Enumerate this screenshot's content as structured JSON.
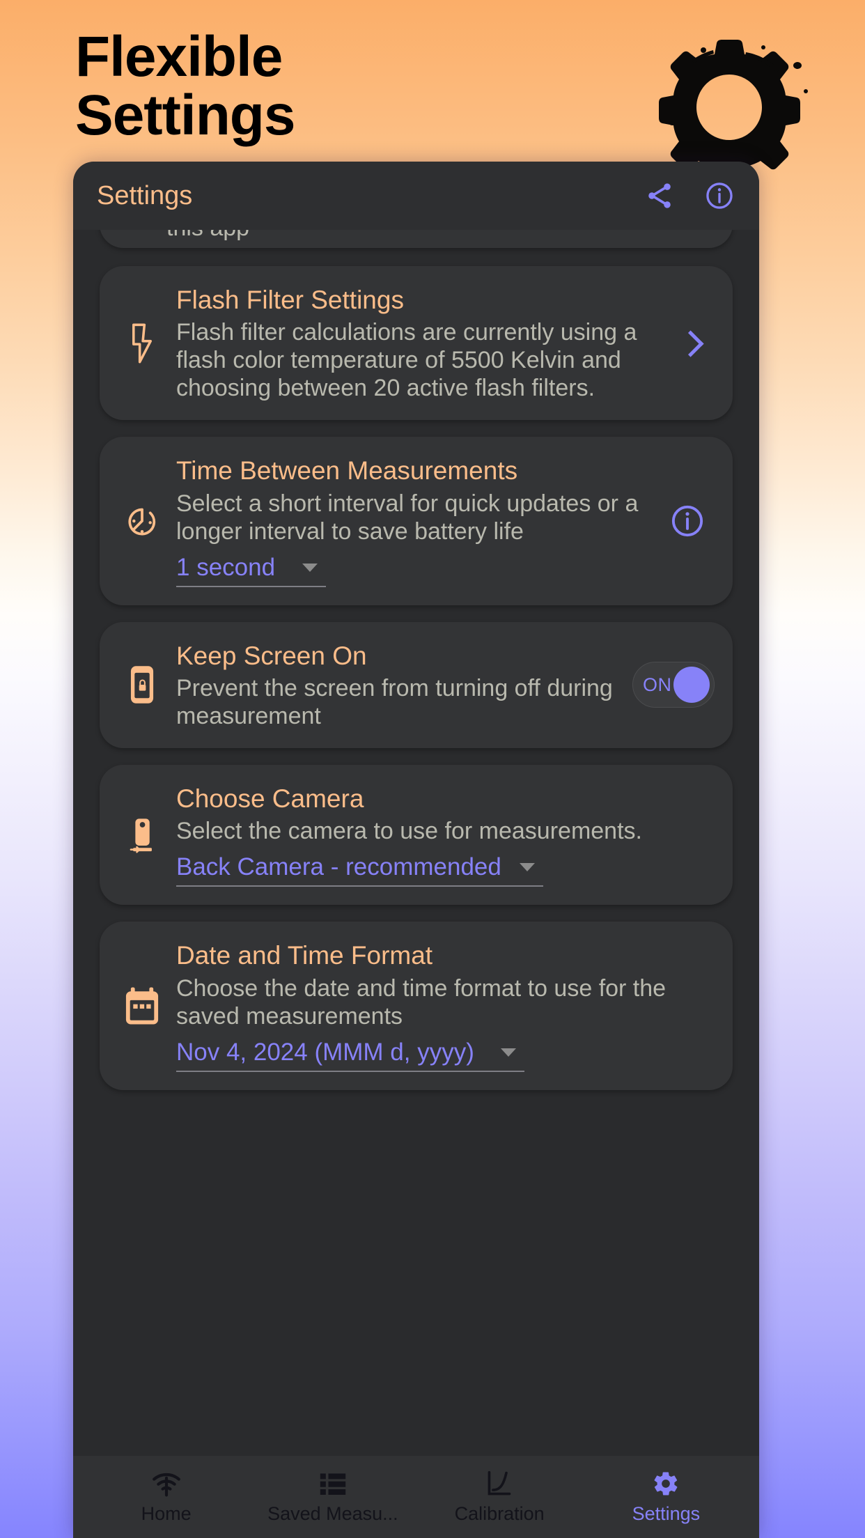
{
  "promo": {
    "title_line1": "Flexible",
    "title_line2": "Settings",
    "gear_icon": "grunge-gear-icon"
  },
  "appbar": {
    "title": "Settings",
    "share_icon": "share-icon",
    "info_icon": "info-circle-icon"
  },
  "cards": [
    {
      "partial": true,
      "visible_text": "this app"
    },
    {
      "icon": "flash-icon",
      "title": "Flash Filter Settings",
      "desc": "Flash filter calculations are currently using a flash color temperature of 5500 Kelvin and choosing between 20 active flash filters.",
      "trailing": "chevron-right-icon",
      "kelvin": "5500",
      "active_filters": "20"
    },
    {
      "icon": "timer-icon",
      "title": "Time Between Measurements",
      "desc": "Select a short interval for quick updates or a longer interval to save battery life",
      "dropdown_value": "1 second",
      "trailing": "info-circle-icon"
    },
    {
      "icon": "phone-lock-icon",
      "title": "Keep Screen On",
      "desc": "Prevent the screen from turning off during measurement",
      "toggle_label": "ON",
      "toggle_state": "on"
    },
    {
      "icon": "camera-icon",
      "title": "Choose Camera",
      "desc": "Select the camera to use for measurements.",
      "dropdown_value": "Back Camera - recommended"
    },
    {
      "icon": "calendar-icon",
      "title": "Date and Time Format",
      "desc": "Choose the date and time format to use for the saved measurements",
      "dropdown_value": "Nov 4, 2024 (MMM d, yyyy)"
    }
  ],
  "bottomnav": {
    "items": [
      {
        "label": "Home",
        "icon": "signal-meter-icon",
        "active": false
      },
      {
        "label": "Saved Measu...",
        "icon": "list-icon",
        "active": false
      },
      {
        "label": "Calibration",
        "icon": "line-chart-icon",
        "active": false
      },
      {
        "label": "Settings",
        "icon": "gear-icon",
        "active": true
      }
    ]
  },
  "colors": {
    "accent_orange": "#FBBD8A",
    "accent_purple": "#8782F8",
    "card_bg": "#333436",
    "phone_bg": "#2A2B2D",
    "desc_text": "#B9B9AE",
    "bg_top": "#FBAE69",
    "bg_bottom": "#8584FE"
  }
}
